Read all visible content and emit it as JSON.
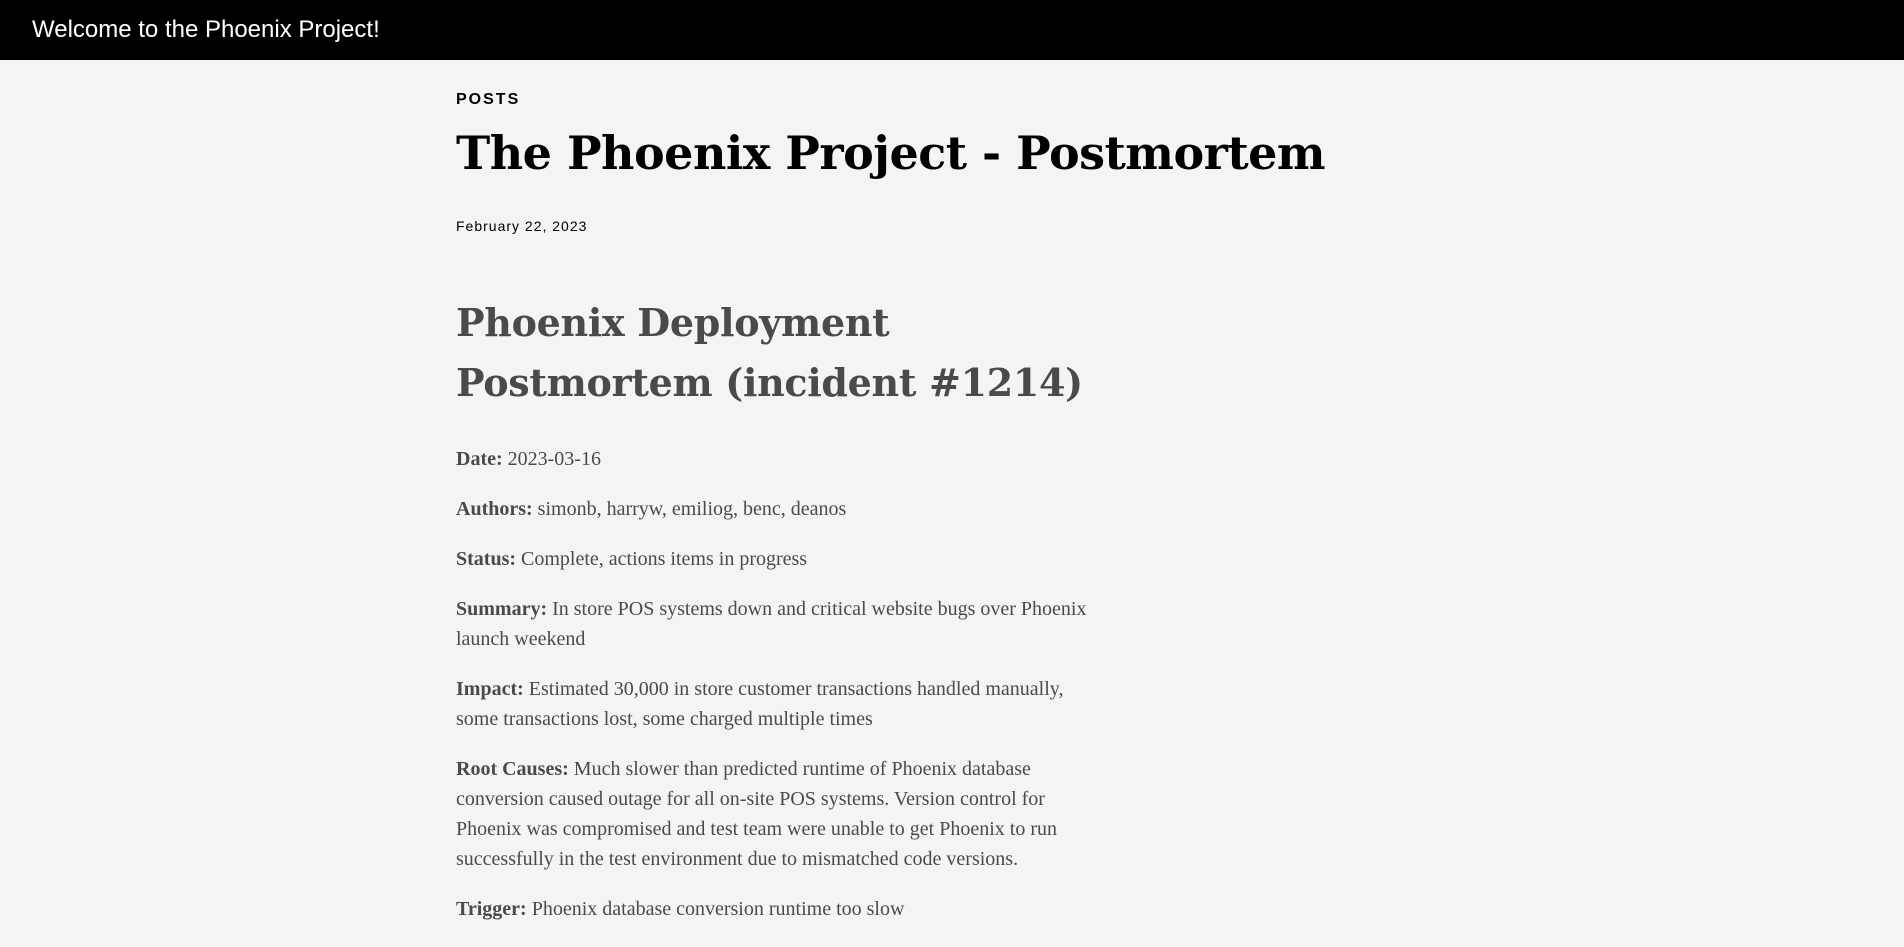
{
  "header": {
    "site_title": "Welcome to the Phoenix Project!"
  },
  "post": {
    "section_label": "POSTS",
    "title": "The Phoenix Project - Postmortem",
    "date": "February 22, 2023",
    "heading": "Phoenix Deployment Postmortem (incident #1214)",
    "fields": [
      {
        "label": "Date:",
        "value": "2023-03-16"
      },
      {
        "label": "Authors:",
        "value": "simonb, harryw, emiliog, benc, deanos"
      },
      {
        "label": "Status:",
        "value": "Complete, actions items in progress"
      },
      {
        "label": "Summary:",
        "value": "In store POS systems down and critical website bugs over Phoenix launch weekend"
      },
      {
        "label": "Impact:",
        "value": "Estimated 30,000 in store customer transactions handled manually, some transactions lost, some charged multiple times"
      },
      {
        "label": "Root Causes:",
        "value": "Much slower than predicted runtime of Phoenix database conversion caused outage for all on-site POS systems. Version control for Phoenix was compromised and test team were unable to get Phoenix to run successfully in the test environment due to mismatched code versions."
      },
      {
        "label": "Trigger:",
        "value": "Phoenix database conversion runtime too slow"
      }
    ]
  },
  "colors": {
    "topbar_bg": "#000000",
    "page_bg": "#f4f4f4",
    "body_text": "#4a4a4a"
  }
}
